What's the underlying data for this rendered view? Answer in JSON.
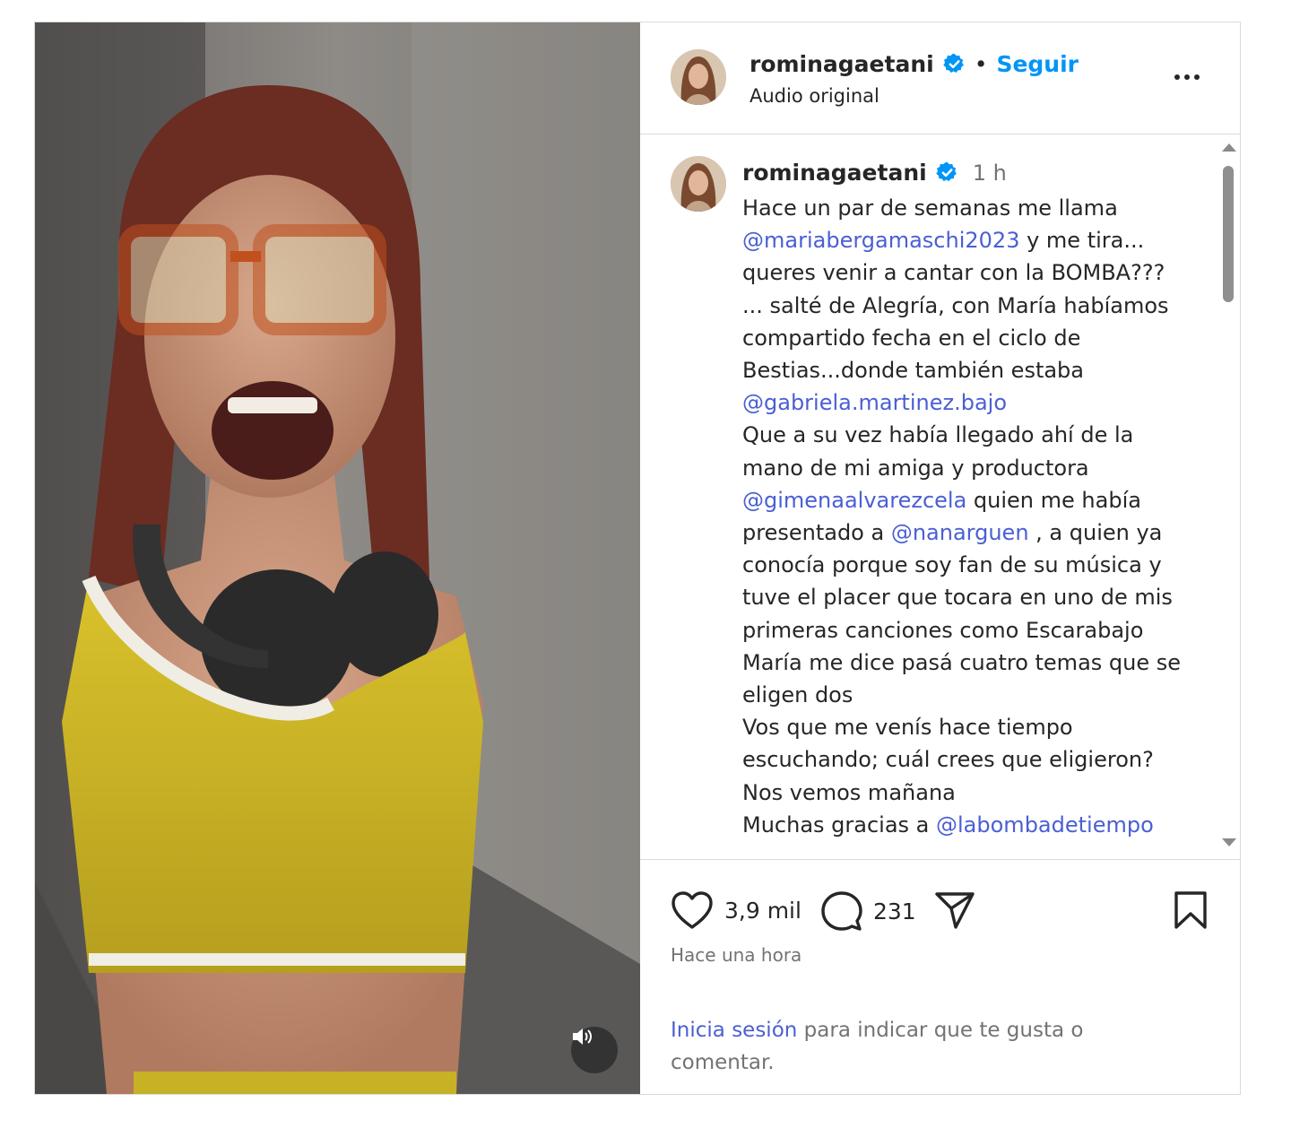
{
  "post": {
    "username": "rominagaetani",
    "follow_label": "Seguir",
    "separator": "•",
    "audio_label": "Audio original"
  },
  "caption": {
    "username": "rominagaetani",
    "time": "1 h",
    "lines": [
      [
        {
          "t": "Hace un par de semanas me llama"
        }
      ],
      [
        {
          "t": "@mariabergamaschi2023",
          "m": true
        },
        {
          "t": "  y me tira..."
        }
      ],
      [
        {
          "t": "queres venir a cantar con la BOMBA???"
        }
      ],
      [
        {
          "t": "... salté de Alegría, con María habíamos"
        }
      ],
      [
        {
          "t": "compartido fecha en el ciclo de"
        }
      ],
      [
        {
          "t": "Bestias...donde también estaba"
        }
      ],
      [
        {
          "t": "@gabriela.martinez.bajo",
          "m": true
        }
      ],
      [
        {
          "t": "Que a su vez había llegado ahí de la"
        }
      ],
      [
        {
          "t": "mano de mi amiga y productora"
        }
      ],
      [
        {
          "t": "@gimenaalvarezcela",
          "m": true
        },
        {
          "t": "  quien me había"
        }
      ],
      [
        {
          "t": "presentado a "
        },
        {
          "t": "@nanarguen",
          "m": true
        },
        {
          "t": " , a quien ya"
        }
      ],
      [
        {
          "t": "conocía porque soy fan de su música y"
        }
      ],
      [
        {
          "t": "tuve el placer que tocara en uno de mis"
        }
      ],
      [
        {
          "t": "primeras canciones como Escarabajo"
        }
      ],
      [
        {
          "t": "María me dice pasá cuatro temas que se"
        }
      ],
      [
        {
          "t": "eligen dos"
        }
      ],
      [
        {
          "t": "Vos que me venís hace tiempo"
        }
      ],
      [
        {
          "t": "escuchando; cuál crees que eligieron?"
        }
      ],
      [
        {
          "t": "Nos vemos mañana"
        }
      ],
      [
        {
          "t": "Muchas gracias a  "
        },
        {
          "t": "@labombadetiempo",
          "m": true
        }
      ]
    ]
  },
  "actions": {
    "likes": "3,9 mil",
    "comments": "231",
    "time_ago": "Hace una hora"
  },
  "login": {
    "link": "Inicia sesión",
    "text": " para indicar que te gusta o comentar."
  },
  "icons": {
    "like": "heart-icon",
    "comment": "comment-bubble-icon",
    "share": "paper-plane-icon",
    "save": "bookmark-icon",
    "verified": "verified-badge-icon",
    "audio": "speaker-icon",
    "more": "more-options-icon"
  },
  "colors": {
    "link": "#0095f6",
    "mention": "#4a5fd4",
    "verified": "#0095f6",
    "muted": "#737373",
    "border": "#dbdbdb"
  }
}
